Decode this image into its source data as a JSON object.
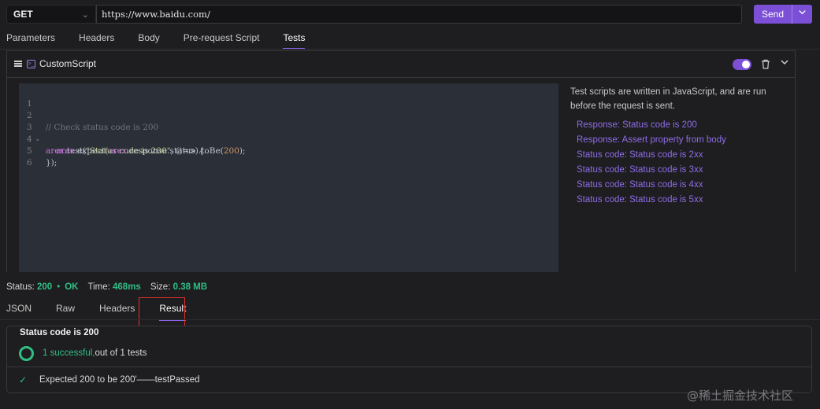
{
  "request": {
    "method": "GET",
    "url": "https://www.baidu.com/",
    "send_label": "Send"
  },
  "request_tabs": [
    "Parameters",
    "Headers",
    "Body",
    "Pre-request Script",
    "Tests"
  ],
  "active_request_tab": "Tests",
  "script_card": {
    "title": "CustomScript",
    "enabled": true,
    "code_lines": [
      {
        "n": "1"
      },
      {
        "n": "2",
        "comment": "// Check status code is 200"
      },
      {
        "n": "3",
        "obj": "arex",
        "fn": ".test(",
        "str": "\"Status code is 200\"",
        "rest": ", ()=> {"
      },
      {
        "n": "4",
        "indent": "    ",
        "obj": "arex",
        "fn": ".expect(",
        "obj2": "arex",
        "mid": ".response.status).toBe(",
        "num": "200",
        "end": ");"
      },
      {
        "n": "5",
        "plain": "});"
      },
      {
        "n": "6"
      }
    ]
  },
  "snippets_panel": {
    "description": "Test scripts are written in JavaScript, and are run before the request is sent.",
    "snippets": [
      "Response: Status code is 200",
      "Response: Assert property from body",
      "Status code: Status code is 2xx",
      "Status code: Status code is 3xx",
      "Status code: Status code is 4xx",
      "Status code: Status code is 5xx"
    ]
  },
  "response_status": {
    "status_label": "Status:",
    "status_code": "200",
    "status_text": "OK",
    "time_label": "Time:",
    "time_value": "468ms",
    "size_label": "Size:",
    "size_value": "0.38 MB"
  },
  "response_tabs": [
    "JSON",
    "Raw",
    "Headers",
    "Result"
  ],
  "active_response_tab": "Result",
  "result": {
    "title": "Status code is 200",
    "successful_text": "1 successful,",
    "summary_rest": "out of 1 tests",
    "assertion": "Expected 200 to be 200'——testPassed"
  },
  "watermark": "@稀土掘金技术社区",
  "colors": {
    "accent": "#7b4fd6",
    "success": "#2fbf85",
    "highlight_box": "#e0312b",
    "background": "#1e1e20"
  }
}
